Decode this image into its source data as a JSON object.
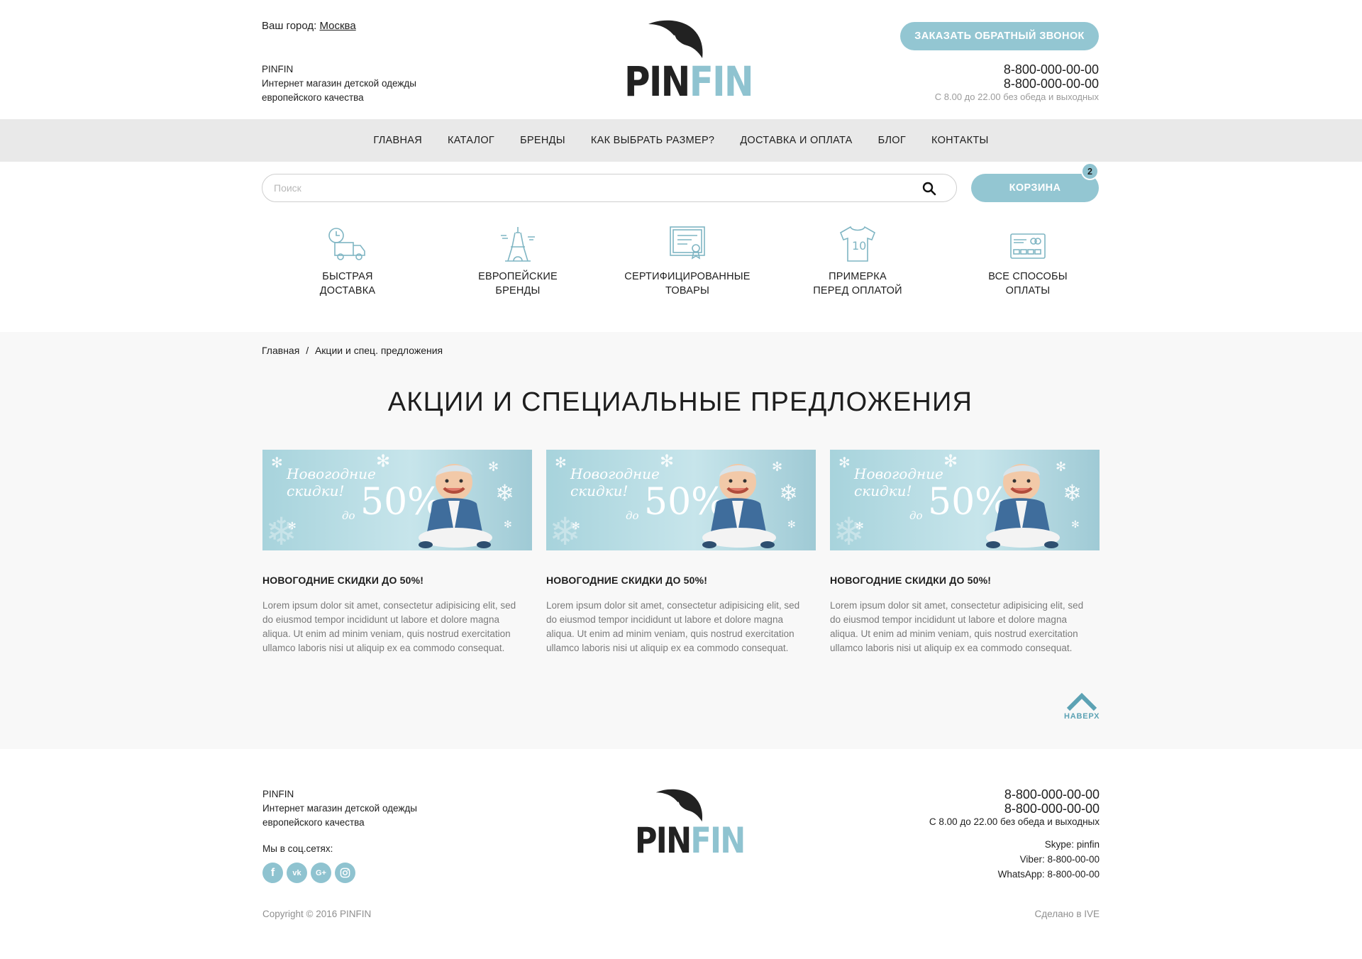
{
  "colors": {
    "accent": "#93c6d2",
    "brand_dark": "#222222",
    "brand_light": "#8fc3d0",
    "nav_bg": "#e9e9e9",
    "main_bg": "#f8f8f8"
  },
  "header": {
    "city_label": "Ваш город:",
    "city_value": "Москва",
    "brand": "PINFIN",
    "tagline_1": "Интернет магазин детской одежды",
    "tagline_2": "европейского качества",
    "logo_pin": "PIN",
    "logo_fin": "FIN",
    "callback_label": "ЗАКАЗАТЬ ОБРАТНЫЙ ЗВОНОК",
    "phone_1": "8-800-000-00-00",
    "phone_2": "8-800-000-00-00",
    "hours": "С 8.00 до 22.00 без обеда и выходных"
  },
  "nav": {
    "items": [
      {
        "label": "ГЛАВНАЯ"
      },
      {
        "label": "КАТАЛОГ"
      },
      {
        "label": "БРЕНДЫ"
      },
      {
        "label": "КАК ВЫБРАТЬ РАЗМЕР?"
      },
      {
        "label": "ДОСТАВКА И ОПЛАТА"
      },
      {
        "label": "БЛОГ"
      },
      {
        "label": "КОНТАКТЫ"
      }
    ]
  },
  "search": {
    "placeholder": "Поиск",
    "value": ""
  },
  "cart": {
    "label": "КОРЗИНА",
    "count": "2"
  },
  "features": [
    {
      "line1": "БЫСТРАЯ",
      "line2": "ДОСТАВКА",
      "icon": "delivery-truck-icon"
    },
    {
      "line1": "ЕВРОПЕЙСКИЕ",
      "line2": "БРЕНДЫ",
      "icon": "eiffel-tower-icon"
    },
    {
      "line1": "СЕРТИФИЦИРОВАННЫЕ",
      "line2": "ТОВАРЫ",
      "icon": "certificate-icon"
    },
    {
      "line1": "ПРИМЕРКА",
      "line2": "ПЕРЕД ОПЛАТОЙ",
      "icon": "tshirt-icon"
    },
    {
      "line1": "ВСЕ СПОСОБЫ",
      "line2": "ОПЛАТЫ",
      "icon": "credit-card-icon"
    }
  ],
  "breadcrumb": {
    "home": "Главная",
    "separator": "/",
    "current": "Акции и спец. предложения"
  },
  "page_title": "АКЦИИ И СПЕЦИАЛЬНЫЕ ПРЕДЛОЖЕНИЯ",
  "promos": [
    {
      "banner_line1": "Новогодние",
      "banner_line2": "скидки!",
      "banner_upto": "до",
      "banner_pct": "50%",
      "title": "НОВОГОДНИЕ СКИДКИ ДО 50%!",
      "text": "Lorem ipsum dolor sit amet, consectetur adipisicing elit, sed do eiusmod tempor incididunt ut labore et dolore magna aliqua. Ut enim ad minim veniam, quis nostrud exercitation ullamco laboris nisi ut aliquip ex ea commodo consequat."
    },
    {
      "banner_line1": "Новогодние",
      "banner_line2": "скидки!",
      "banner_upto": "до",
      "banner_pct": "50%",
      "title": "НОВОГОДНИЕ СКИДКИ ДО 50%!",
      "text": "Lorem ipsum dolor sit amet, consectetur adipisicing elit, sed do eiusmod tempor incididunt ut labore et dolore magna aliqua. Ut enim ad minim veniam, quis nostrud exercitation ullamco laboris nisi ut aliquip ex ea commodo consequat."
    },
    {
      "banner_line1": "Новогодние",
      "banner_line2": "скидки!",
      "banner_upto": "до",
      "banner_pct": "50%",
      "title": "НОВОГОДНИЕ СКИДКИ ДО 50%!",
      "text": "Lorem ipsum dolor sit amet, consectetur adipisicing elit, sed do eiusmod tempor incididunt ut labore et dolore magna aliqua. Ut enim ad minim veniam, quis nostrud exercitation ullamco laboris nisi ut aliquip ex ea commodo consequat."
    }
  ],
  "to_top_label": "НАВЕРХ",
  "footer": {
    "brand": "PINFIN",
    "tagline_1": "Интернет магазин детской одежды",
    "tagline_2": "европейского качества",
    "social_label": "Мы в соц.сетях:",
    "social": [
      {
        "name": "facebook-icon",
        "glyph": "f"
      },
      {
        "name": "vk-icon",
        "glyph": "vk"
      },
      {
        "name": "google-plus-icon",
        "glyph": "G+"
      },
      {
        "name": "instagram-icon",
        "glyph": ""
      }
    ],
    "logo_pin": "PIN",
    "logo_fin": "FIN",
    "phone_1": "8-800-000-00-00",
    "phone_2": "8-800-000-00-00",
    "hours": "С 8.00 до 22.00 без обеда и выходных",
    "skype": "Skype: pinfin",
    "viber": "Viber: 8-800-00-00",
    "whatsapp": "WhatsApp: 8-800-00-00",
    "copyright": "Copyright © 2016 PINFIN",
    "made_by": "Сделано в IVE"
  }
}
